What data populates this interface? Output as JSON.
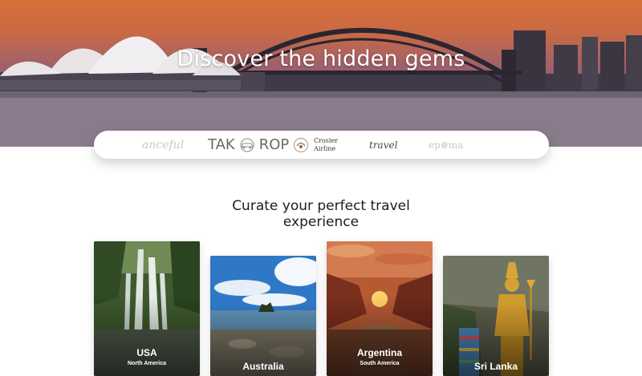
{
  "hero": {
    "title": "Discover the hidden gems"
  },
  "partners": {
    "logos": [
      {
        "name": "anceful-logo",
        "text": "anceful"
      },
      {
        "name": "takerop-logo",
        "left": "TAK",
        "right": "ROP"
      },
      {
        "name": "crosier-airline-logo",
        "line1": "Crosier",
        "line2": "Airline"
      },
      {
        "name": "travel-logo",
        "text": "travel"
      },
      {
        "name": "epoma-logo",
        "text": "ep⊕ma"
      }
    ]
  },
  "section": {
    "title_line1": "Curate your perfect travel",
    "title_line2": "experience"
  },
  "destinations": [
    {
      "country": "USA",
      "region": "North America"
    },
    {
      "country": "Australia",
      "region": ""
    },
    {
      "country": "Argentina",
      "region": "South America"
    },
    {
      "country": "Sri Lanka",
      "region": ""
    }
  ]
}
